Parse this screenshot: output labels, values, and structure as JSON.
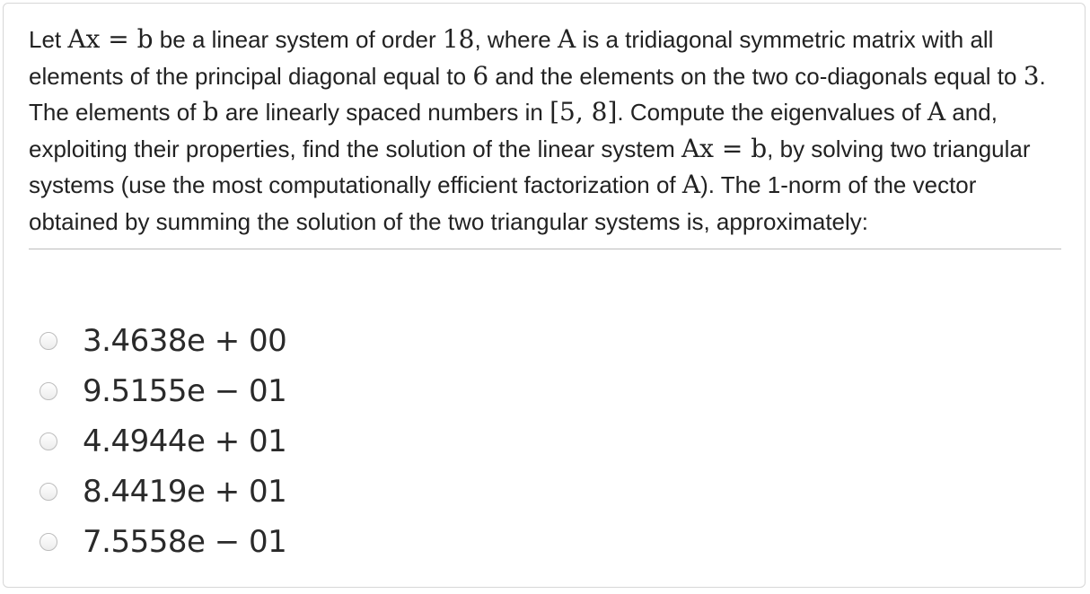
{
  "question": {
    "t1": "Let ",
    "m1": "Ax = b",
    "t2": " be a linear system of order ",
    "m2": "18",
    "t3": ", where ",
    "m3": "A",
    "t4": " is a tridiagonal symmetric matrix with all elements of the principal diagonal equal to ",
    "m4": "6",
    "t5": " and the elements on the two co-diagonals equal to ",
    "m5": "3",
    "t6": ". The elements of ",
    "m6": "b",
    "t7": " are linearly spaced numbers in ",
    "m7": "[5, 8]",
    "t8": ". Compute the eigenvalues of ",
    "m8": "A",
    "t9": " and, exploiting their properties, find the solution of the linear system ",
    "m9": "Ax = b",
    "t10": ", by solving two triangular systems (use the most computationally efficient factorization of ",
    "m10": "A",
    "t11": "). The 1-norm of the vector obtained by summing the solution of the two triangular systems is, approximately:"
  },
  "choices": [
    {
      "label": "3.4638e + 00"
    },
    {
      "label": "9.5155e − 01"
    },
    {
      "label": "4.4944e + 01"
    },
    {
      "label": "8.4419e + 01"
    },
    {
      "label": "7.5558e − 01"
    }
  ]
}
